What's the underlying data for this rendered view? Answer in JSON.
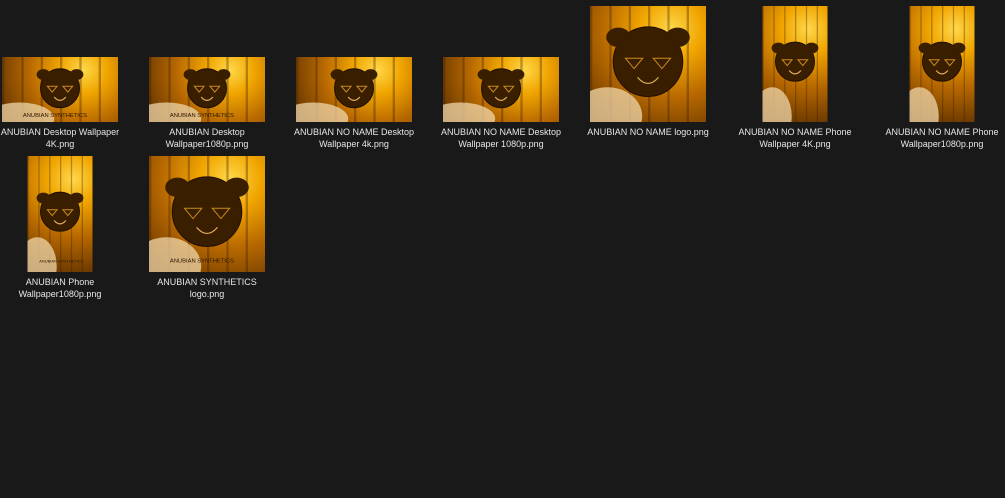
{
  "files": [
    {
      "name": "ANUBIAN Desktop Wallpaper\n4K.png",
      "preview": "landscape",
      "caption_text": "ANUBIAN SYNTHETICS"
    },
    {
      "name": "ANUBIAN Desktop\nWallpaper1080p.png",
      "preview": "landscape",
      "caption_text": "ANUBIAN SYNTHETICS"
    },
    {
      "name": "ANUBIAN NO NAME Desktop\nWallpaper 4k.png",
      "preview": "landscape",
      "caption_text": ""
    },
    {
      "name": "ANUBIAN NO NAME Desktop\nWallpaper 1080p.png",
      "preview": "landscape",
      "caption_text": ""
    },
    {
      "name": "ANUBIAN NO NAME logo.png",
      "preview": "square",
      "caption_text": ""
    },
    {
      "name": "ANUBIAN NO NAME Phone\nWallpaper 4K.png",
      "preview": "portrait",
      "caption_text": ""
    },
    {
      "name": "ANUBIAN NO NAME Phone\nWallpaper1080p.png",
      "preview": "portrait",
      "caption_text": ""
    },
    {
      "name": "ANUBIAN Phone\nWallpaper1080p.png",
      "preview": "portrait",
      "caption_text": "ANUBIAN SYNTHETICS"
    },
    {
      "name": "ANUBIAN SYNTHETICS\nlogo.png",
      "preview": "square",
      "caption_text": "ANUBIAN SYNTHETICS"
    }
  ],
  "colors": {
    "background": "#191919",
    "label": "#e6e6e6",
    "gold": "#f0a500",
    "dark": "#3a1e00"
  }
}
